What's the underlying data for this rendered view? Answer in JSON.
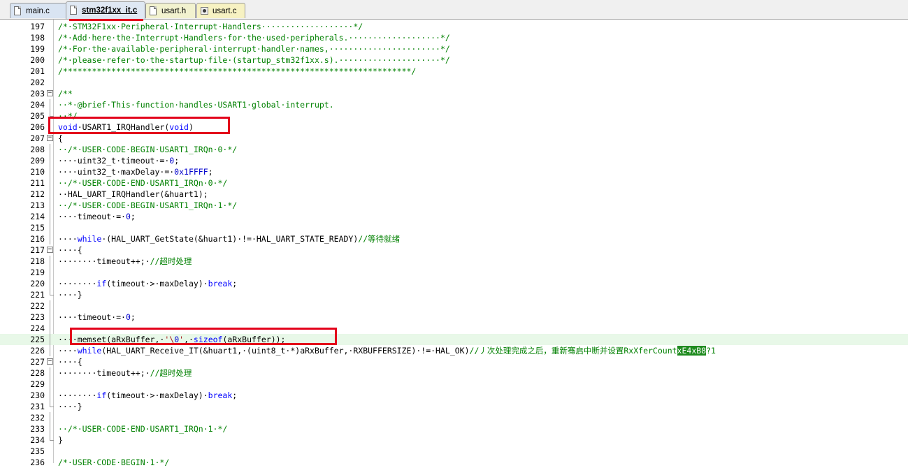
{
  "tabs": [
    {
      "label": "main.c",
      "icon": "c-file-icon"
    },
    {
      "label": "stm32f1xx_it.c",
      "icon": "c-file-icon",
      "active": true
    },
    {
      "label": "usart.h",
      "icon": "h-file-icon"
    },
    {
      "label": "usart.c",
      "icon": "c-gear-file-icon"
    }
  ],
  "code_lines": [
    {
      "n": "197",
      "t": "/*·STM32F1xx·Peripheral·Interrupt·Handlers···················*/"
    },
    {
      "n": "198",
      "t": "/*·Add·here·the·Interrupt·Handlers·for·the·used·peripherals.···················*/"
    },
    {
      "n": "199",
      "t": "/*·For·the·available·peripheral·interrupt·handler·names,·······················*/"
    },
    {
      "n": "200",
      "t": "/*·please·refer·to·the·startup·file·(startup_stm32f1xx.s).·····················*/"
    },
    {
      "n": "201",
      "t": "/************************************************************************/"
    },
    {
      "n": "202",
      "t": ""
    },
    {
      "n": "203",
      "t": "/**"
    },
    {
      "n": "204",
      "t": "··*·@brief·This·function·handles·USART1·global·interrupt."
    },
    {
      "n": "205",
      "t": "··*/"
    },
    {
      "n": "206",
      "t": "void·USART1_IRQHandler(void)"
    },
    {
      "n": "207",
      "t": "{"
    },
    {
      "n": "208",
      "t": "··/*·USER·CODE·BEGIN·USART1_IRQn·0·*/"
    },
    {
      "n": "209",
      "t": "····uint32_t·timeout·=·0;"
    },
    {
      "n": "210",
      "t": "····uint32_t·maxDelay·=·0x1FFFF;"
    },
    {
      "n": "211",
      "t": "··/*·USER·CODE·END·USART1_IRQn·0·*/"
    },
    {
      "n": "212",
      "t": "··HAL_UART_IRQHandler(&huart1);"
    },
    {
      "n": "213",
      "t": "··/*·USER·CODE·BEGIN·USART1_IRQn·1·*/"
    },
    {
      "n": "214",
      "t": "····timeout·=·0;"
    },
    {
      "n": "215",
      "t": ""
    },
    {
      "n": "216",
      "t": "····while·(HAL_UART_GetState(&huart1)·!=·HAL_UART_STATE_READY)//等待就绪"
    },
    {
      "n": "217",
      "t": "····{"
    },
    {
      "n": "218",
      "t": "········timeout++;·//超时处理"
    },
    {
      "n": "219",
      "t": ""
    },
    {
      "n": "220",
      "t": "········if(timeout·>·maxDelay)·break;"
    },
    {
      "n": "221",
      "t": "····}"
    },
    {
      "n": "222",
      "t": ""
    },
    {
      "n": "223",
      "t": "····timeout·=·0;"
    },
    {
      "n": "224",
      "t": ""
    },
    {
      "n": "225",
      "t": "····memset(aRxBuffer,·'\\0',·sizeof(aRxBuffer));"
    },
    {
      "n": "226",
      "t": "····while(HAL_UART_Receive_IT(&huart1,·(uint8_t·*)aRxBuffer,·RXBUFFERSIZE)·!=·HAL_OK)//丿次处理完成之后，重新骞启中断并设置RxXferCount"
    },
    {
      "n": "227",
      "t": "····{"
    },
    {
      "n": "228",
      "t": "········timeout++;·//超时处理"
    },
    {
      "n": "229",
      "t": ""
    },
    {
      "n": "230",
      "t": "········if(timeout·>·maxDelay)·break;"
    },
    {
      "n": "231",
      "t": "····}"
    },
    {
      "n": "232",
      "t": ""
    },
    {
      "n": "233",
      "t": "··/*·USER·CODE·END·USART1_IRQn·1·*/"
    },
    {
      "n": "234",
      "t": "}"
    },
    {
      "n": "235",
      "t": ""
    },
    {
      "n": "236",
      "t": "/*·USER·CODE·BEGIN·1·*/"
    }
  ],
  "line226_tail": {
    "sel1": "xE4",
    "sel2": "xB8",
    "rest": "?1"
  },
  "colors": {
    "comment": "#008000",
    "keyword": "#0000ff",
    "number": "#0000cd",
    "annotation_box": "#e3001b",
    "current_line": "#e8f8e8"
  }
}
